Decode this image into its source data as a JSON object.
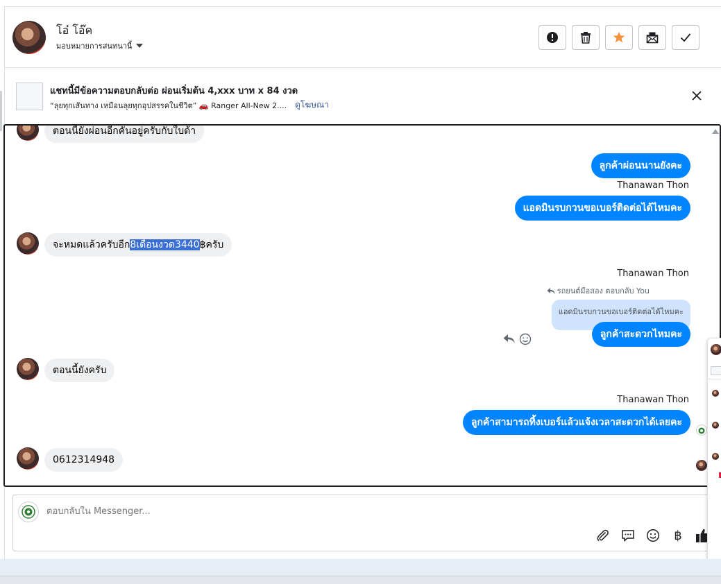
{
  "header": {
    "contact_name": "โอ๋ โอ๊ค",
    "assign_label": "มอบหมายการสนทนานี้",
    "actions": [
      {
        "icon": "alert-icon",
        "name": "mark-spam-button"
      },
      {
        "icon": "trash-icon",
        "name": "delete-button"
      },
      {
        "icon": "star-icon",
        "name": "star-button"
      },
      {
        "icon": "mail-unread-icon",
        "name": "mark-unread-button"
      },
      {
        "icon": "check-icon",
        "name": "mark-done-button"
      }
    ],
    "star_color": "#f7923a"
  },
  "ad": {
    "title": "แชทนี้มีข้อความตอบกลับต่อ ผ่อนเริ่มต้น 4,xxx บาท x 84 งวด",
    "subtitle": "“ลุยทุกเส้นทาง เหมือนลุยทุกอุปสรรคในชีวิต” 🚗 Ranger All-New 2....",
    "link_label": "ดูโฆษณา"
  },
  "messages": [
    {
      "dir": "in",
      "text": "ตอนนี้ยังผ่อนอีกคันอยู่ครับกับใบด้า"
    },
    {
      "dir": "out",
      "text": "ลูกค้าผ่อนนานยังคะ"
    },
    {
      "dir": "out",
      "sender": "Thanawan Thon",
      "text": "แอดมินรบกวนขอเบอร์ติดต่อได้ไหมคะ"
    },
    {
      "dir": "in",
      "text_before": "จะหมดแล้วครับอีก",
      "text_highlight": "8เดือนงวด3440",
      "text_after": "฿ครับ"
    },
    {
      "dir": "out",
      "sender": "Thanawan Thon",
      "reply_note": "รถยนต์มือสอง ตอบกลับ You",
      "quoted": "แอดมินรบกวนขอเบอร์ติดต่อได้ไหมคะ",
      "text": "ลูกค้าสะดวกไหมคะ"
    },
    {
      "dir": "in",
      "text": "ตอนนี้ยังครับ"
    },
    {
      "dir": "out",
      "sender": "Thanawan Thon",
      "text": "ลูกค้าสามารถทิ้งเบอร์แล้วแจ้งเวลาสะดวกได้เลยคะ"
    },
    {
      "dir": "in",
      "text": "0612314948"
    }
  ],
  "composer": {
    "placeholder": "ตอบกลับใน Messenger...",
    "tools": [
      "paperclip-icon",
      "quick-reply-icon",
      "emoji-icon",
      "baht-icon",
      "thumbs-up-icon"
    ],
    "baht_symbol": "฿"
  },
  "colors": {
    "outgoing_bubble": "#0084ff",
    "incoming_bubble": "#eff0f2",
    "highlight": "#3a6fd8",
    "quoted_bubble": "#cfe3fd"
  }
}
